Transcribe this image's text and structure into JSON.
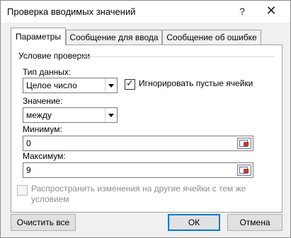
{
  "window": {
    "title": "Проверка вводимых значений",
    "help": "?",
    "close": "✕"
  },
  "tabs": [
    {
      "label": "Параметры",
      "active": true
    },
    {
      "label": "Сообщение для ввода",
      "active": false
    },
    {
      "label": "Сообщение об ошибке",
      "active": false
    }
  ],
  "group": {
    "title": "Условие проверки"
  },
  "data_type": {
    "label": "Тип данных:",
    "value": "Целое число"
  },
  "ignore_blank": {
    "label": "Игнорировать пустые ячейки",
    "checked": true
  },
  "condition": {
    "label": "Значение:",
    "value": "между"
  },
  "minimum": {
    "label": "Минимум:",
    "value": "0"
  },
  "maximum": {
    "label": "Максимум:",
    "value": "9"
  },
  "apply_all": {
    "label_line1": "Распространить изменения на другие ячейки с тем же",
    "label_line2": "условием",
    "checked": false,
    "enabled": false
  },
  "buttons": {
    "clear_all": "Очистить все",
    "ok": "ОК",
    "cancel": "Отмена"
  }
}
